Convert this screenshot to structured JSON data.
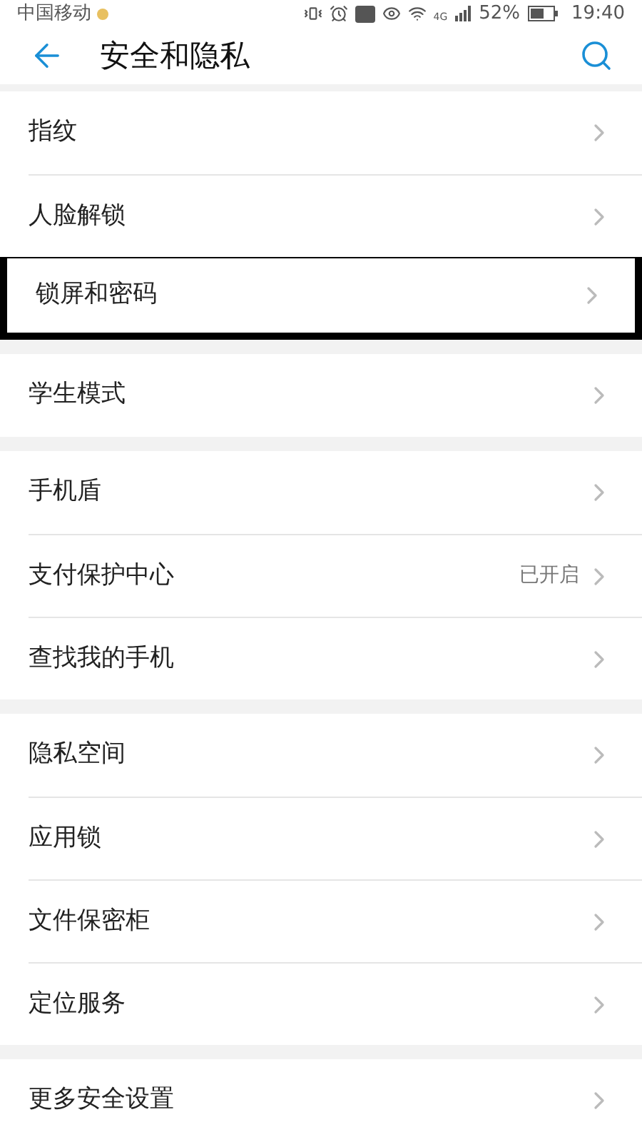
{
  "status_bar": {
    "carrier": "中国移动",
    "network": "4G",
    "battery": "52%",
    "time": "19:40"
  },
  "header": {
    "title": "安全和隐私"
  },
  "groups": [
    {
      "items": [
        {
          "label": "指纹",
          "highlighted": false
        },
        {
          "label": "人脸解锁",
          "highlighted": false
        },
        {
          "label": "锁屏和密码",
          "highlighted": true
        }
      ]
    },
    {
      "items": [
        {
          "label": "学生模式",
          "highlighted": false
        }
      ]
    },
    {
      "items": [
        {
          "label": "手机盾",
          "highlighted": false
        },
        {
          "label": "支付保护中心",
          "value": "已开启",
          "highlighted": false
        },
        {
          "label": "查找我的手机",
          "highlighted": false
        }
      ]
    },
    {
      "items": [
        {
          "label": "隐私空间",
          "highlighted": false
        },
        {
          "label": "应用锁",
          "highlighted": false
        },
        {
          "label": "文件保密柜",
          "highlighted": false
        },
        {
          "label": "定位服务",
          "highlighted": false
        }
      ]
    },
    {
      "items": [
        {
          "label": "更多安全设置",
          "highlighted": false
        }
      ]
    }
  ]
}
